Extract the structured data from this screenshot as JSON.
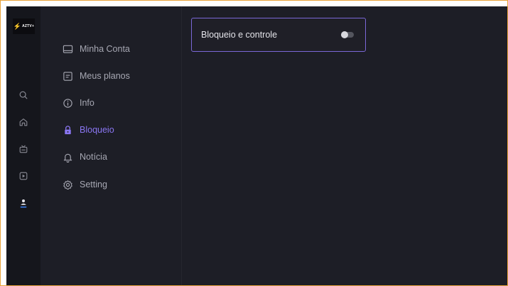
{
  "logo": {
    "text": "AZTV+",
    "bolt": "⚡"
  },
  "rail": {
    "icons": [
      "search-icon",
      "home-icon",
      "tv-icon",
      "play-icon",
      "user-icon"
    ],
    "active_icon": "user-icon",
    "accent": "#3b82f6"
  },
  "menu": {
    "items": [
      {
        "label": "Minha Conta",
        "icon": "account-card-icon",
        "active": false
      },
      {
        "label": "Meus planos",
        "icon": "plans-icon",
        "active": false
      },
      {
        "label": "Info",
        "icon": "info-icon",
        "active": false
      },
      {
        "label": "Bloqueio",
        "icon": "lock-icon",
        "active": true
      },
      {
        "label": "Notícia",
        "icon": "bell-icon",
        "active": false
      },
      {
        "label": "Setting",
        "icon": "gear-icon",
        "active": false
      }
    ],
    "active_color": "#8a76f2"
  },
  "content": {
    "lock_control": {
      "label": "Bloqueio e controle",
      "enabled": false
    }
  },
  "colors": {
    "background": "#1d1e26",
    "rail": "#15161c",
    "card_border": "#7b68d8"
  }
}
